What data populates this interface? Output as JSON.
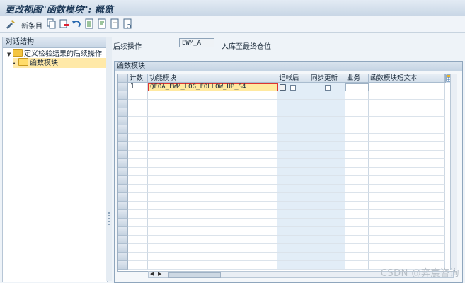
{
  "window": {
    "title": "更改视图\"函数模块\": 概览"
  },
  "toolbar": {
    "new_entries_label": "新条目"
  },
  "nav": {
    "header": "对话结构",
    "items": [
      {
        "label": "定义检验结果的后续操作"
      },
      {
        "label": "函数模块"
      }
    ]
  },
  "form": {
    "followup_label": "后续操作",
    "followup_value": "EWM_A",
    "followup_desc": "入库至最终仓位"
  },
  "group": {
    "title": "函数模块"
  },
  "table": {
    "columns": [
      "计数",
      "功能模块",
      "记帐后",
      "同步更新",
      "业务",
      "函数模块短文本"
    ],
    "rows": [
      {
        "count": "1",
        "function_module": "QFOA_EWM_LOG_FOLLOW_UP_S4"
      }
    ]
  },
  "watermark": "CSDN @弈宸咨询"
}
